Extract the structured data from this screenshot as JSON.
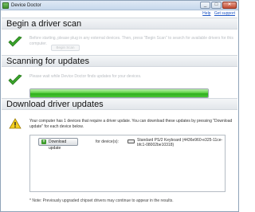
{
  "window": {
    "title": "Device Doctor",
    "controls": [
      "_",
      "□",
      "✕"
    ]
  },
  "links": {
    "help": "Help",
    "support": "Get support"
  },
  "scan": {
    "title": "Begin a driver scan",
    "description": "Before starting, please plug in any external devices. Then, press \"Begin Scan\" to search for available drivers for this computer.",
    "button": "Begin Scan"
  },
  "updates": {
    "title": "Scanning for updates",
    "description": "Please wait while Device Doctor finds updates for your devices.",
    "progress": 1.0
  },
  "download": {
    "title": "Download driver updates",
    "message": "Your computer has 1 devices that require a driver update. You can download these updates by pressing \"Download update\" for each device below.",
    "button": "Download update",
    "for_label": "for device(s):",
    "device": "Standard PS/2 Keyboard (4436e960-e325-11ce-bfc1-08002be10318)",
    "note": "* Note: Previously upgraded chipset drivers may continue to appear in the results."
  }
}
